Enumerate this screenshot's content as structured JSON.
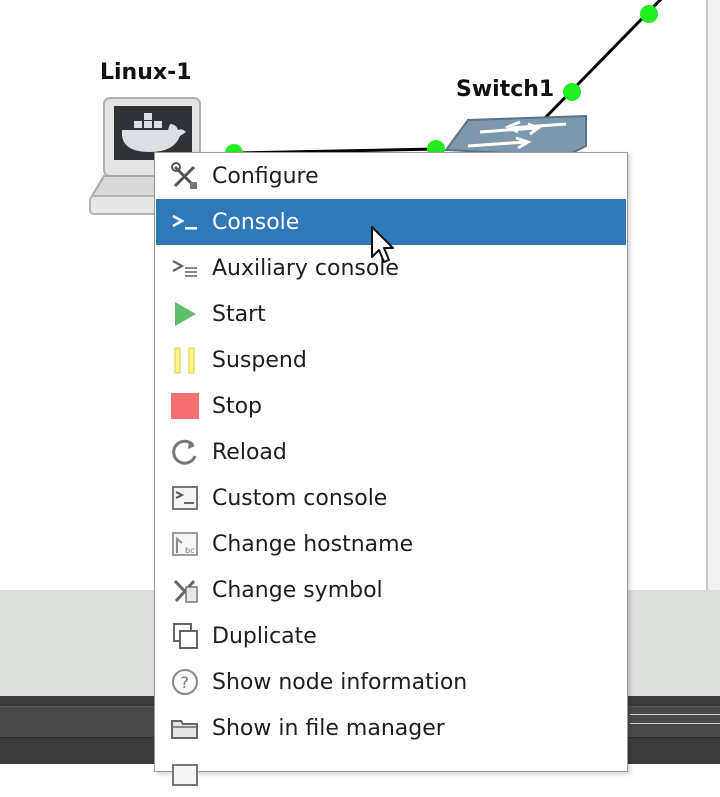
{
  "topology": {
    "nodes": [
      {
        "name": "Linux-1",
        "icon": "docker-host-icon"
      },
      {
        "name": "Switch1",
        "icon": "ethernet-switch-icon"
      }
    ],
    "link_status_color": "#22ee22"
  },
  "context_menu": {
    "highlight_color": "#3079b8",
    "items": [
      {
        "label": "Configure",
        "icon": "configure-icon"
      },
      {
        "label": "Console",
        "icon": "console-icon",
        "active": true
      },
      {
        "label": "Auxiliary console",
        "icon": "auxiliary-console-icon"
      },
      {
        "label": "Start",
        "icon": "start-icon"
      },
      {
        "label": "Suspend",
        "icon": "suspend-icon"
      },
      {
        "label": "Stop",
        "icon": "stop-icon"
      },
      {
        "label": "Reload",
        "icon": "reload-icon"
      },
      {
        "label": "Custom console",
        "icon": "custom-console-icon"
      },
      {
        "label": "Change hostname",
        "icon": "change-hostname-icon"
      },
      {
        "label": "Change symbol",
        "icon": "change-symbol-icon"
      },
      {
        "label": "Duplicate",
        "icon": "duplicate-icon"
      },
      {
        "label": "Show node information",
        "icon": "info-icon"
      },
      {
        "label": "Show in file manager",
        "icon": "folder-icon"
      }
    ]
  }
}
